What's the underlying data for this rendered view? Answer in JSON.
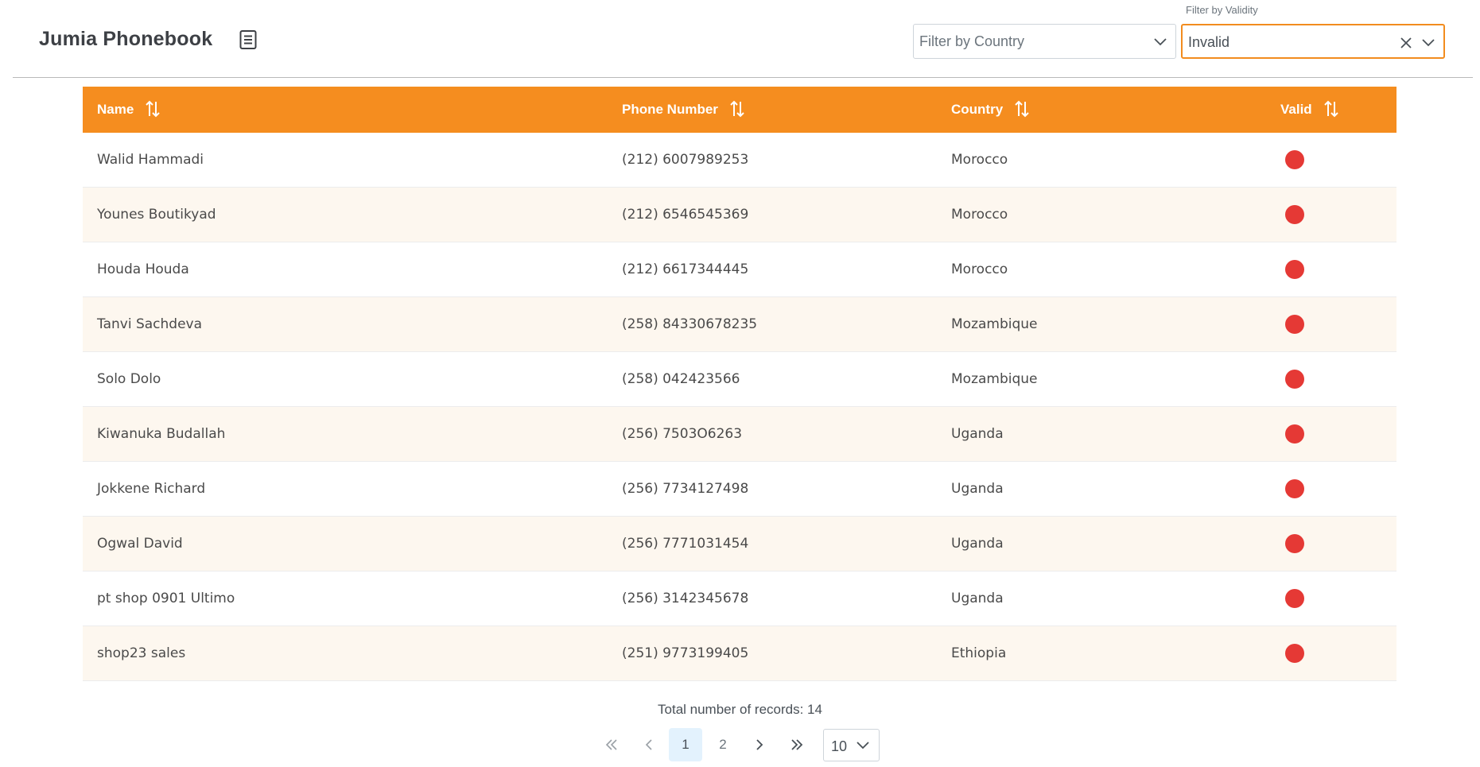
{
  "header": {
    "title": "Jumia Phonebook",
    "title_icon": "document-list-icon"
  },
  "filters": {
    "country": {
      "placeholder": "Filter by Country",
      "value": ""
    },
    "validity": {
      "label": "Filter by Validity",
      "value": "Invalid"
    }
  },
  "table": {
    "columns": [
      {
        "label": "Name"
      },
      {
        "label": "Phone Number"
      },
      {
        "label": "Country"
      },
      {
        "label": "Valid"
      }
    ],
    "rows": [
      {
        "name": "Walid Hammadi",
        "phone": "(212) 6007989253",
        "country": "Morocco",
        "valid": false
      },
      {
        "name": "Younes Boutikyad",
        "phone": "(212) 6546545369",
        "country": "Morocco",
        "valid": false
      },
      {
        "name": "Houda Houda",
        "phone": "(212) 6617344445",
        "country": "Morocco",
        "valid": false
      },
      {
        "name": "Tanvi Sachdeva",
        "phone": "(258) 84330678235",
        "country": "Mozambique",
        "valid": false
      },
      {
        "name": "Solo Dolo",
        "phone": "(258) 042423566",
        "country": "Mozambique",
        "valid": false
      },
      {
        "name": "Kiwanuka Budallah",
        "phone": "(256) 7503O6263",
        "country": "Uganda",
        "valid": false
      },
      {
        "name": "Jokkene Richard",
        "phone": "(256) 7734127498",
        "country": "Uganda",
        "valid": false
      },
      {
        "name": "Ogwal David",
        "phone": "(256) 7771031454",
        "country": "Uganda",
        "valid": false
      },
      {
        "name": "pt shop 0901 Ultimo",
        "phone": "(256) 3142345678",
        "country": "Uganda",
        "valid": false
      },
      {
        "name": "shop23 sales",
        "phone": "(251) 9773199405",
        "country": "Ethiopia",
        "valid": false
      }
    ]
  },
  "footer": {
    "total_label": "Total number of records: 14",
    "pages": [
      "1",
      "2"
    ],
    "current_page": "1",
    "rows_per_page": "10"
  },
  "colors": {
    "accent": "#f58d1f",
    "invalid": "#e53935",
    "row_alt": "#fdf7ef",
    "active_page": "#e3f2fd"
  }
}
